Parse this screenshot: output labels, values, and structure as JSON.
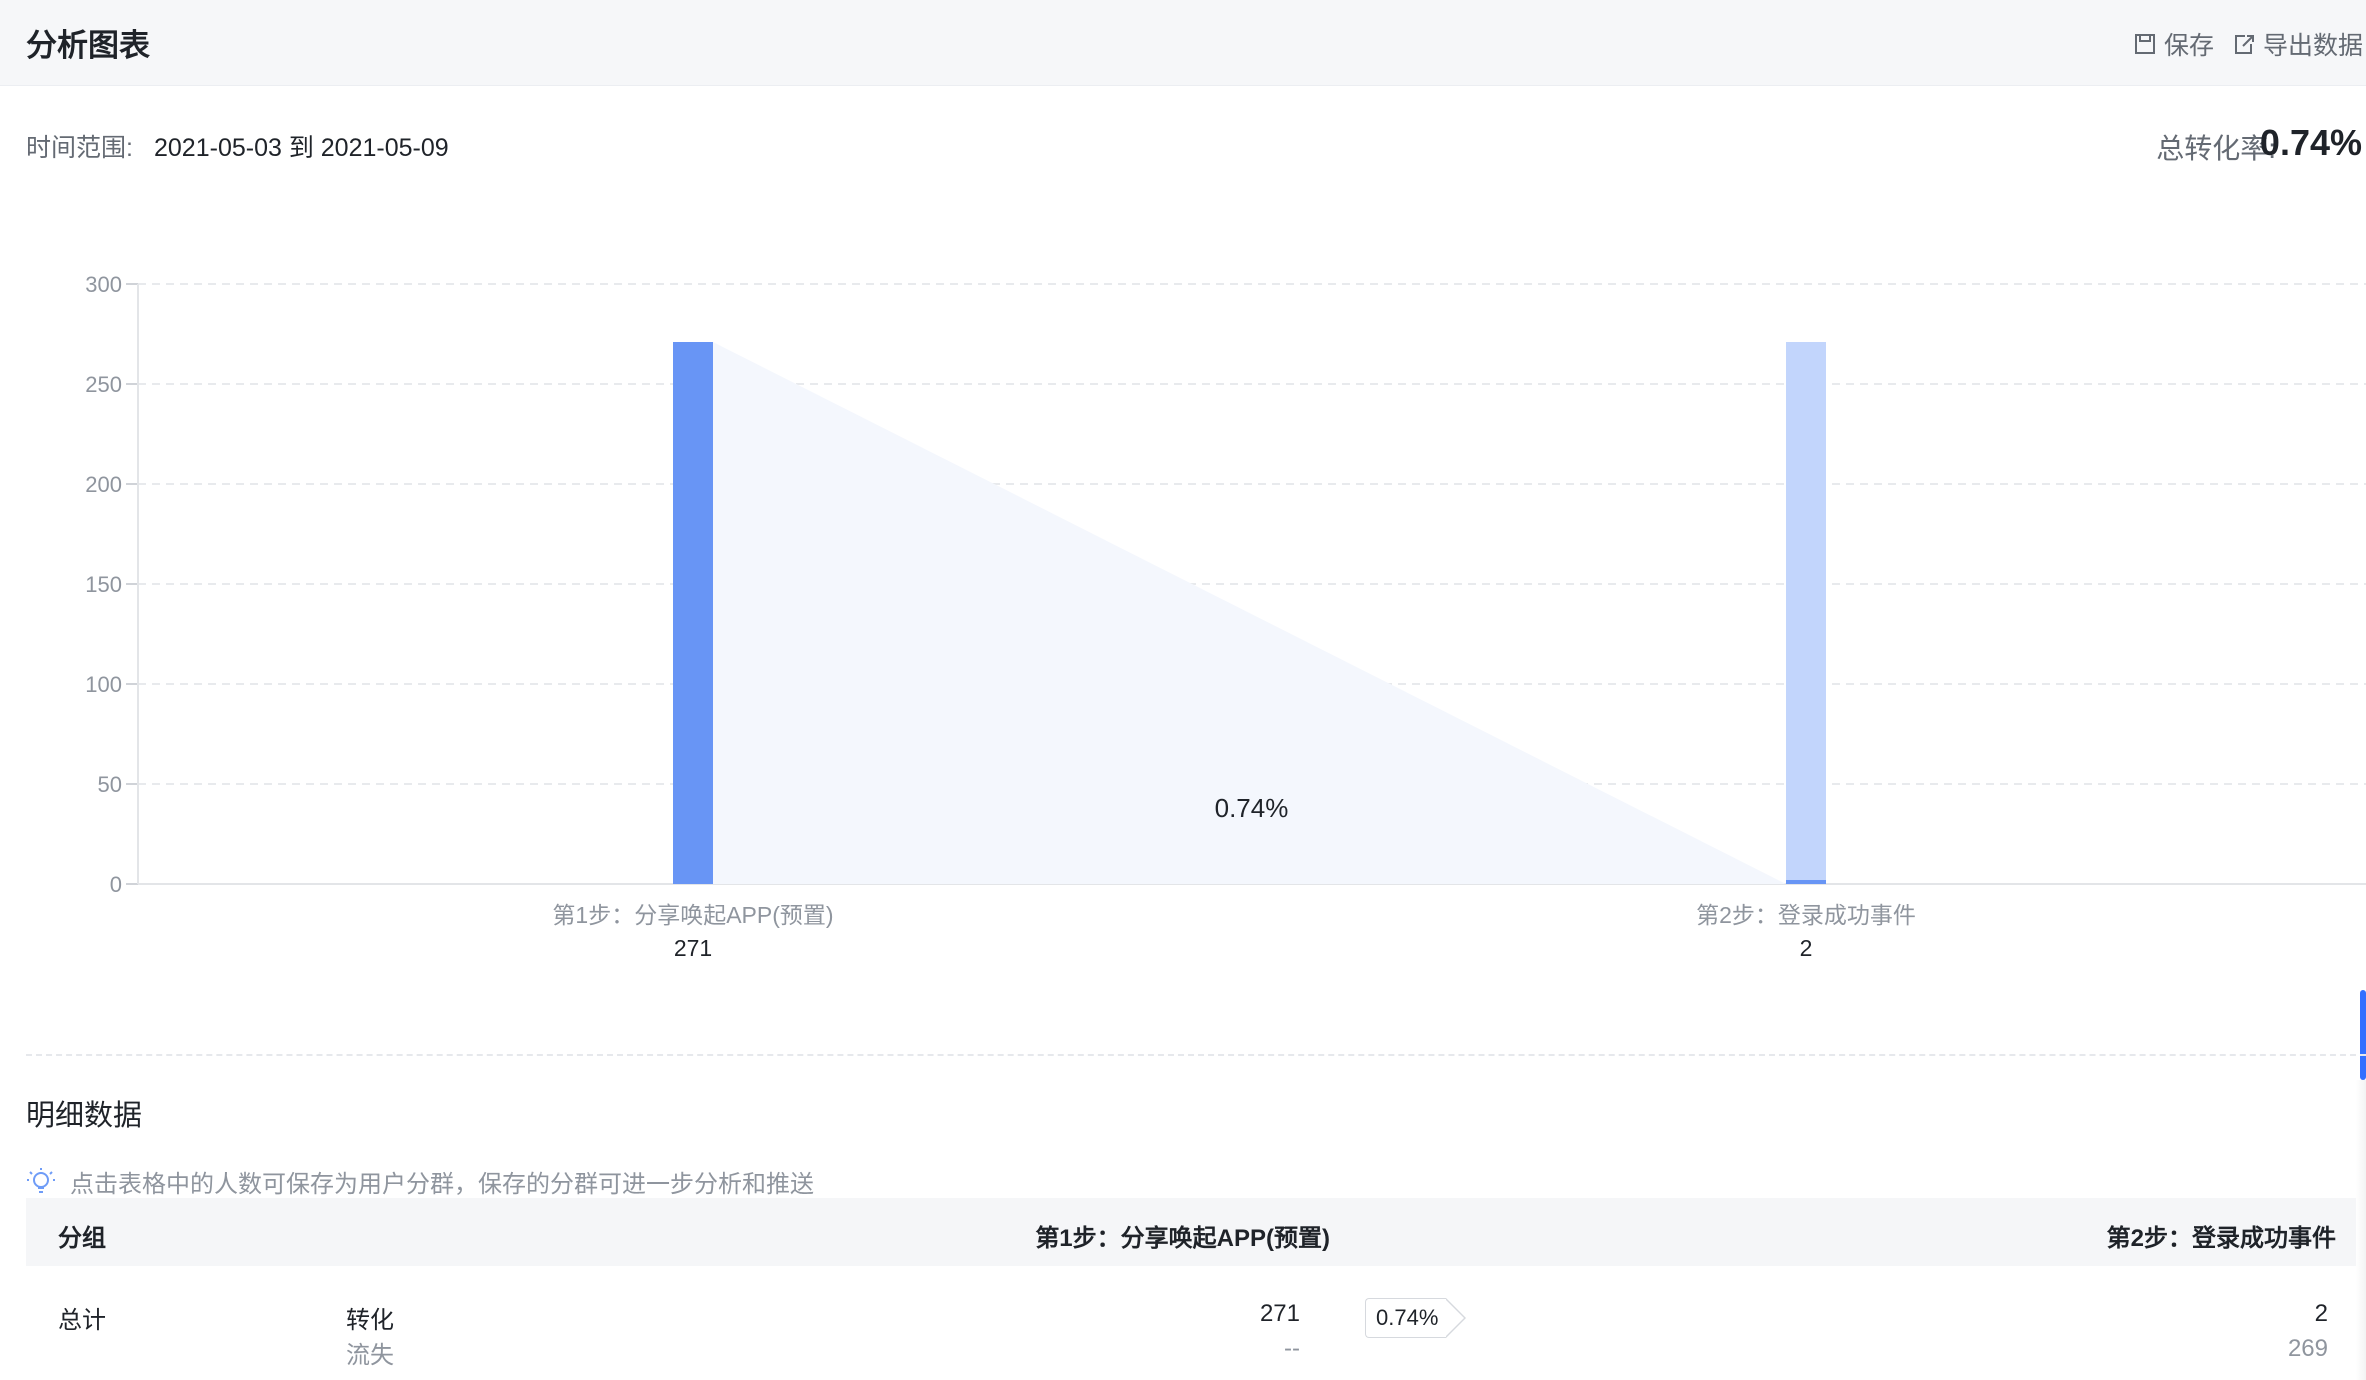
{
  "header": {
    "title": "分析图表",
    "save_label": "保存",
    "export_label": "导出数据"
  },
  "summary": {
    "range_label": "时间范围:",
    "range_value": "2021-05-03 到 2021-05-09",
    "rate_label": "总转化率:",
    "rate_value": "0.74%"
  },
  "chart_data": {
    "type": "bar",
    "categories": [
      "第1步：分享唤起APP(预置)",
      "第2步：登录成功事件"
    ],
    "values": [
      271,
      2
    ],
    "totals_label": [
      "271",
      "2"
    ],
    "conversion_label": "0.74%",
    "ylim": [
      0,
      300
    ],
    "yticks": [
      0,
      50,
      100,
      150,
      200,
      250,
      300
    ],
    "grid": true,
    "colors": {
      "step1": "#6895f5",
      "step2_background": "#c2d5fc",
      "step2": "#6895f5",
      "funnel_fill": "#f4f7fd"
    }
  },
  "detail": {
    "title": "明细数据",
    "tip": "点击表格中的人数可保存为用户分群，保存的分群可进一步分析和推送",
    "columns": [
      "分组",
      "第1步：分享唤起APP(预置)",
      "第2步：登录成功事件"
    ],
    "rows": [
      {
        "group": "总计",
        "converted_label": "转化",
        "lost_label": "流失",
        "step1_converted": "271",
        "step1_lost": "--",
        "rate": "0.74%",
        "step2_converted": "2",
        "step2_lost": "269"
      }
    ]
  }
}
